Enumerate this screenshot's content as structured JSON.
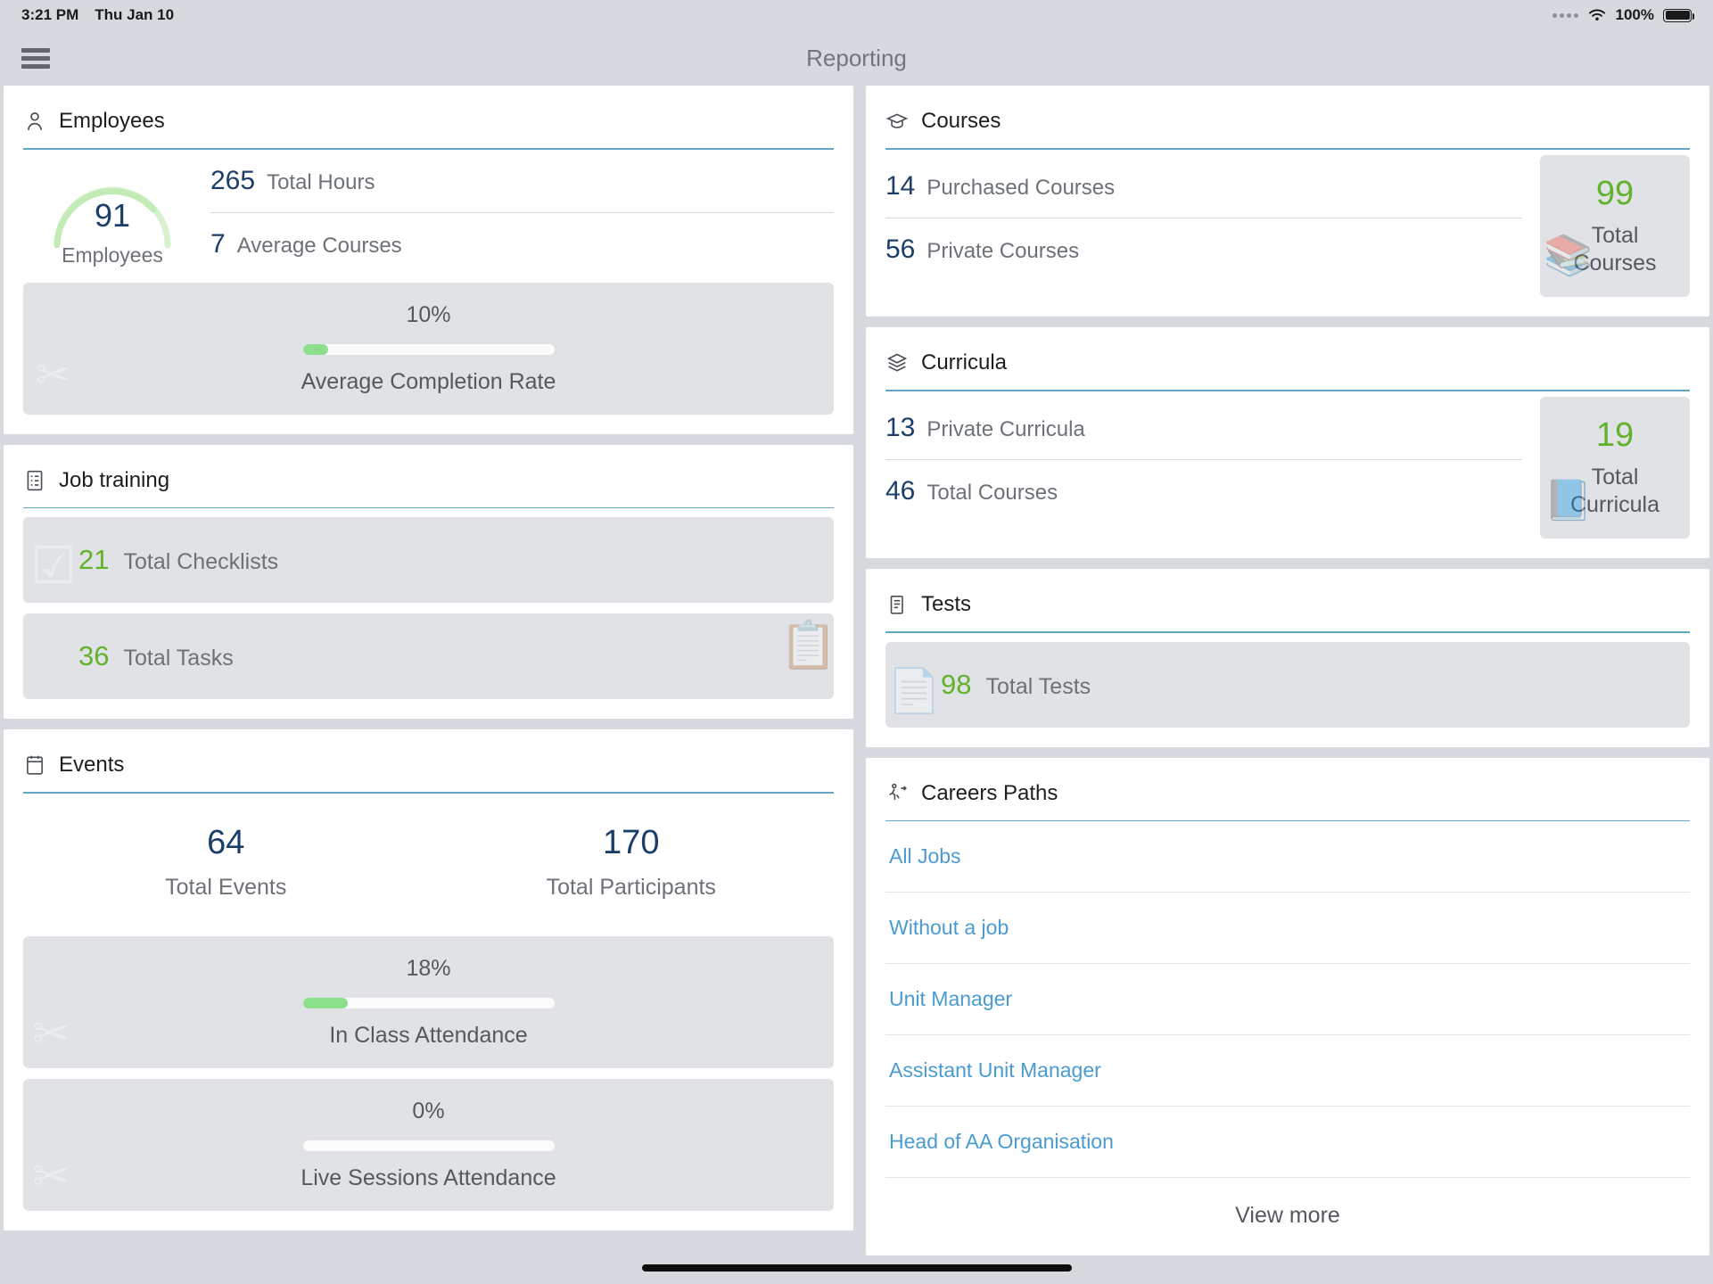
{
  "status_bar": {
    "time": "3:21 PM",
    "date": "Thu Jan 10",
    "battery_percent": "100%",
    "wifi_icon": "wifi-icon",
    "battery_icon": "battery-icon"
  },
  "nav": {
    "menu_icon": "hamburger-menu-icon",
    "title": "Reporting"
  },
  "employees": {
    "icon": "person-icon",
    "title": "Employees",
    "gauge_value": "91",
    "gauge_label": "Employees",
    "stats": [
      {
        "value": "265",
        "label": "Total Hours"
      },
      {
        "value": "7",
        "label": "Average Courses"
      }
    ],
    "completion": {
      "percent_text": "10%",
      "percent_value": 10,
      "label": "Average Completion Rate"
    }
  },
  "job_training": {
    "icon": "checklist-icon",
    "title": "Job training",
    "tiles": [
      {
        "value": "21",
        "label": "Total Checklists"
      },
      {
        "value": "36",
        "label": "Total Tasks"
      }
    ]
  },
  "events": {
    "icon": "calendar-icon",
    "title": "Events",
    "totals": [
      {
        "value": "64",
        "label": "Total Events"
      },
      {
        "value": "170",
        "label": "Total Participants"
      }
    ],
    "progress": [
      {
        "percent_text": "18%",
        "percent_value": 18,
        "label": "In Class Attendance"
      },
      {
        "percent_text": "0%",
        "percent_value": 0,
        "label": "Live Sessions Attendance"
      }
    ]
  },
  "courses": {
    "icon": "graduation-cap-icon",
    "title": "Courses",
    "stats": [
      {
        "value": "14",
        "label": "Purchased Courses"
      },
      {
        "value": "56",
        "label": "Private Courses"
      }
    ],
    "total": {
      "value": "99",
      "label_line1": "Total",
      "label_line2": "Courses"
    }
  },
  "curricula": {
    "icon": "curricula-icon",
    "title": "Curricula",
    "stats": [
      {
        "value": "13",
        "label": "Private Curricula"
      },
      {
        "value": "46",
        "label": "Total Courses"
      }
    ],
    "total": {
      "value": "19",
      "label_line1": "Total",
      "label_line2": "Curricula"
    }
  },
  "tests": {
    "icon": "test-document-icon",
    "title": "Tests",
    "tile": {
      "value": "98",
      "label": "Total Tests"
    }
  },
  "careers_paths": {
    "icon": "career-path-icon",
    "title": "Careers Paths",
    "jobs": [
      "All Jobs",
      "Without a job",
      "Unit Manager",
      "Assistant Unit Manager",
      "Head of AA Organisation"
    ],
    "view_more": "View more"
  },
  "colors": {
    "accent_rule": "#63a7c4",
    "number_blue": "#1c3f69",
    "number_green": "#62b22d",
    "link_blue": "#4a9bd1",
    "progress_green": "#8ce08c",
    "tile_gray": "#e0e2e5",
    "page_bg": "#d6d9dd"
  }
}
